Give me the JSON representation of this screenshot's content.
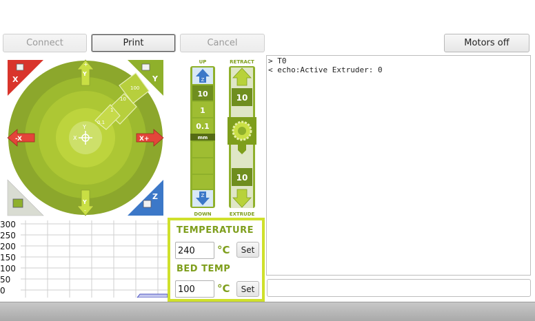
{
  "toolbar": {
    "connect_label": "Connect",
    "print_label": "Print",
    "cancel_label": "Cancel",
    "motors_off_label": "Motors off"
  },
  "xy_pad": {
    "x_minus": "-X",
    "x_plus": "X+",
    "y_plus": "Y",
    "y_minus": "Y",
    "center_y": "Y",
    "center_x": "X",
    "home_x": "X",
    "home_y": "Y",
    "home_z": "Z",
    "step_01": "0.1",
    "step_1": "1",
    "step_10": "10",
    "step_100": "100",
    "plus_sign": "+",
    "minus_sign": "-"
  },
  "z_pad": {
    "up_label": "UP",
    "down_label": "DOWN",
    "step_10": "10",
    "step_1": "1",
    "step_01": "0.1",
    "unit": "mm",
    "z_up_arrow": "Z",
    "z_down_arrow": "Z"
  },
  "extruder": {
    "retract_label": "RETRACT",
    "extrude_label": "EXTRUDE",
    "retract_amount": "10",
    "extrude_amount": "10"
  },
  "temperature": {
    "title": "TEMPERATURE",
    "value": "240",
    "unit": "°C",
    "set_label": "Set",
    "bed_title": "BED TEMP",
    "bed_value": "100",
    "bed_unit": "°C",
    "bed_set_label": "Set"
  },
  "graph": {
    "ticks": [
      "300",
      "250",
      "200",
      "150",
      "100",
      "50",
      "0"
    ]
  },
  "log": {
    "lines": [
      "> T0",
      "< echo:Active Extruder: 0"
    ]
  },
  "colors": {
    "accent_green": "#8fb02b",
    "panel_border": "#cfe02c",
    "x_red": "#d9342b",
    "z_blue": "#3c78c8"
  }
}
